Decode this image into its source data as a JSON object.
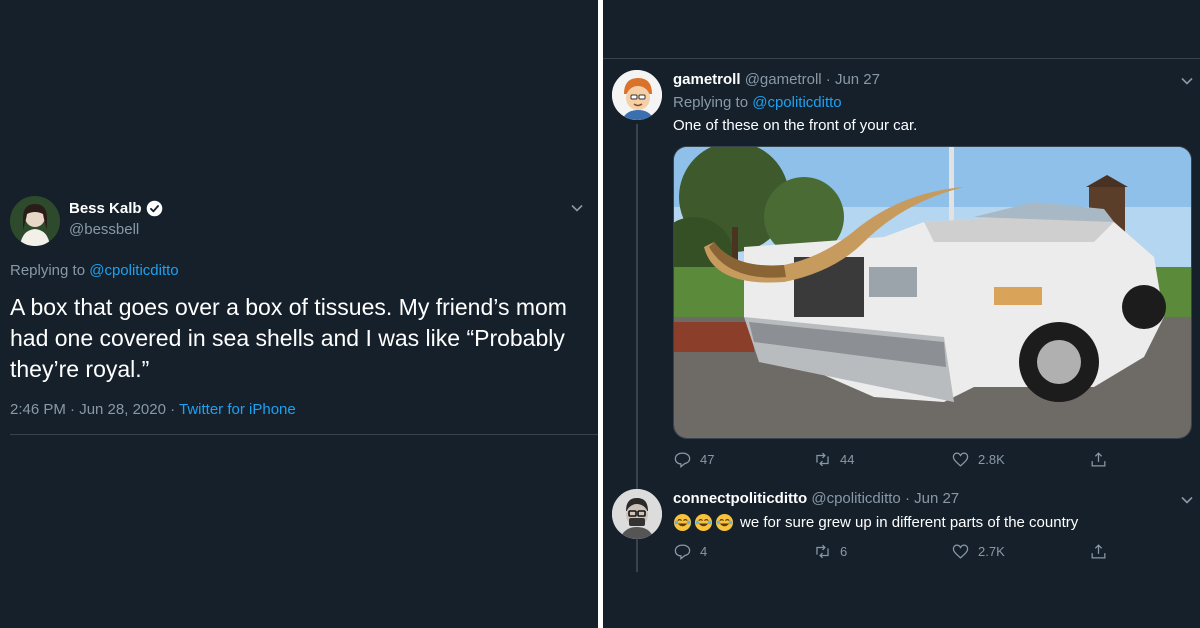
{
  "left_tweet": {
    "author_name": "Bess Kalb",
    "author_handle": "@bessbell",
    "replying_to_prefix": "Replying to ",
    "replying_to_handle": "@cpoliticditto",
    "text": "A box that goes over a box of tissues. My friend’s mom had one covered in sea shells and I was like “Probably they’re royal.”",
    "timestamp": "2:46 PM · Jun 28, 2020 · ",
    "source": "Twitter for iPhone",
    "icons": {
      "verified": "verified-badge-icon",
      "menu": "chevron-down-icon"
    }
  },
  "right_thread": {
    "reply1": {
      "author_name": "gametroll",
      "author_handle": "@gametroll",
      "date": " · Jun 27",
      "replying_to_prefix": "Replying to ",
      "replying_to_handle": "@cpoliticditto",
      "text": "One of these on the front of your car.",
      "media_description": "white convertible car with longhorn bull horns mounted on the hood",
      "counts": {
        "replies": "47",
        "retweets": "44",
        "likes": "2.8K"
      }
    },
    "reply2": {
      "author_name": "connectpoliticditto",
      "author_handle": "@cpoliticditto",
      "date": " · Jun 27",
      "emojis": [
        "tears-of-joy-emoji",
        "tears-of-joy-emoji",
        "tears-of-joy-emoji"
      ],
      "text": "we for sure grew up in different parts of the country",
      "counts": {
        "replies": "4",
        "retweets": "6",
        "likes": "2.7K"
      }
    }
  },
  "colors": {
    "background": "#15202b",
    "link": "#1da1f2",
    "secondary_text": "#8899a6",
    "primary_text": "#ffffff",
    "border": "#38444d"
  }
}
